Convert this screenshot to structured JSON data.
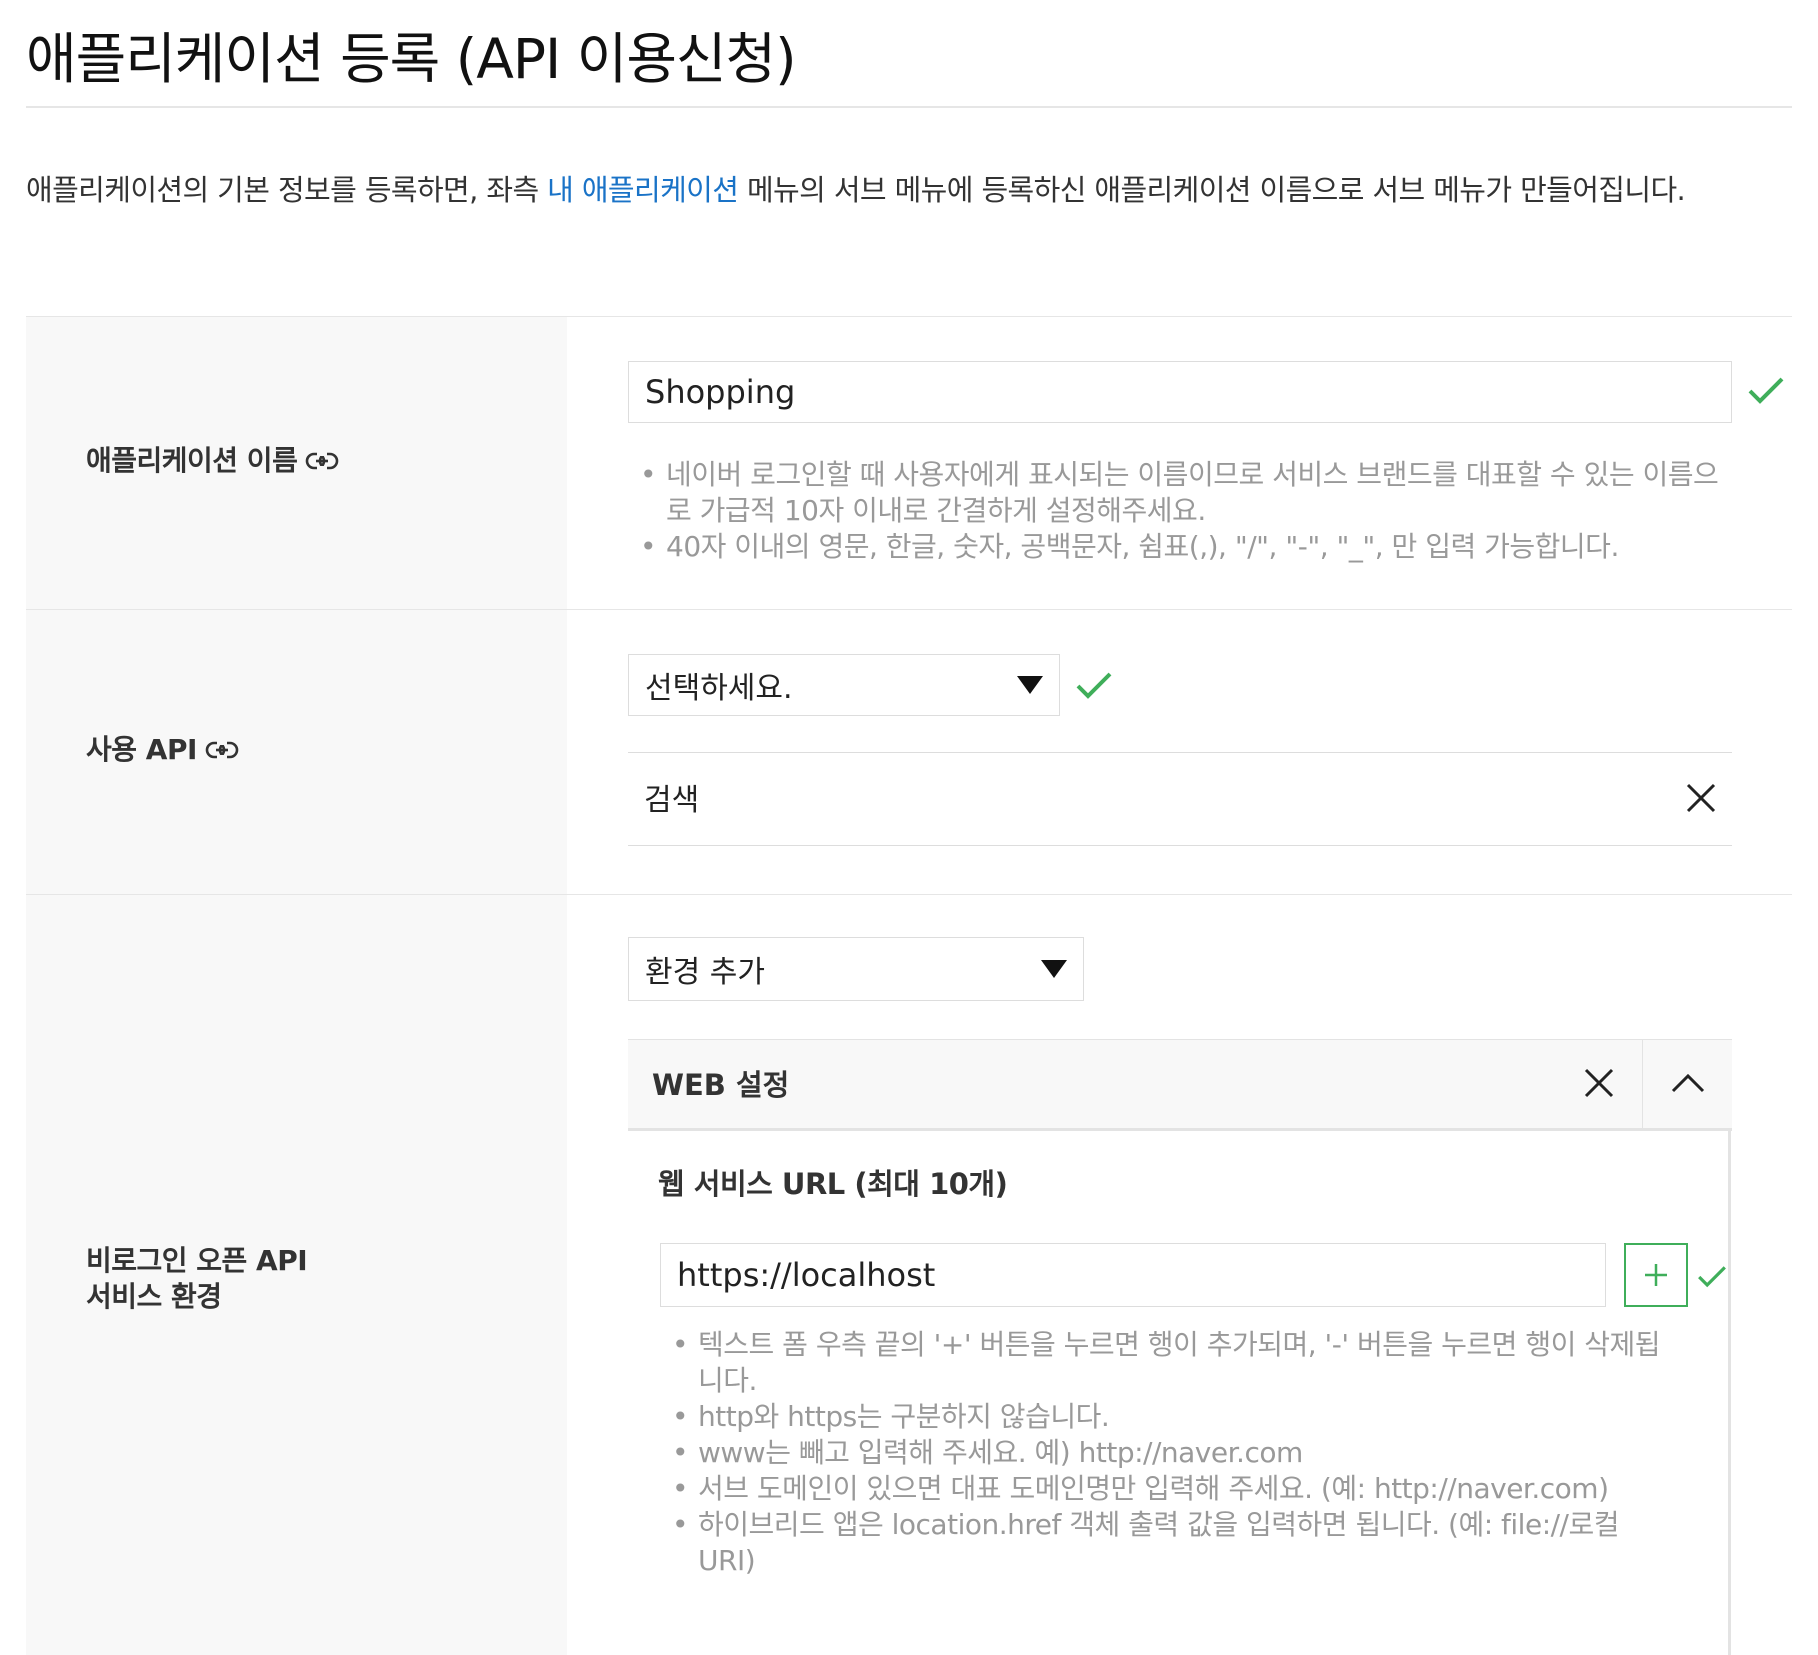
{
  "page": {
    "title": "애플리케이션 등록 (API 이용신청)",
    "intro_before": "애플리케이션의 기본 정보를 등록하면, 좌측 ",
    "intro_link": "내 애플리케이션",
    "intro_after": " 메뉴의 서브 메뉴에 등록하신 애플리케이션 이름으로 서브 메뉴가 만들어집니다."
  },
  "app_name": {
    "label": "애플리케이션 이름",
    "value": "Shopping",
    "help": [
      "네이버 로그인할 때 사용자에게 표시되는 이름이므로 서비스 브랜드를 대표할 수 있는 이름으로 가급적 10자 이내로 간결하게 설정해주세요.",
      "40자 이내의 영문, 한글, 숫자, 공백문자, 쉼표(,), \"/\", \"-\", \"_\", 만 입력 가능합니다."
    ]
  },
  "api": {
    "label": "사용 API",
    "select_value": "선택하세요.",
    "items": [
      {
        "name": "검색"
      }
    ]
  },
  "env": {
    "label_line1": "비로그인 오픈 API",
    "label_line2": "서비스 환경",
    "select_value": "환경 추가",
    "panel_title": "WEB 설정",
    "url_heading": "웹 서비스 URL (최대 10개)",
    "url_value": "https://localhost",
    "help": [
      "텍스트 폼 우측 끝의 '+' 버튼을 누르면 행이 추가되며, '-' 버튼을 누르면 행이 삭제됩니다.",
      "http와 https는 구분하지 않습니다.",
      "www는 빼고 입력해 주세요. 예) http://naver.com",
      "서브 도메인이 있으면 대표 도메인명만 입력해 주세요. (예: http://naver.com)",
      "하이브리드 앱은 location.href 객체 출력 값을 입력하면 됩니다. (예: file://로컬 URI)"
    ]
  },
  "colors": {
    "check": "#3fae5a",
    "link": "#1a73c7",
    "label_bg": "#f8f8f8"
  }
}
